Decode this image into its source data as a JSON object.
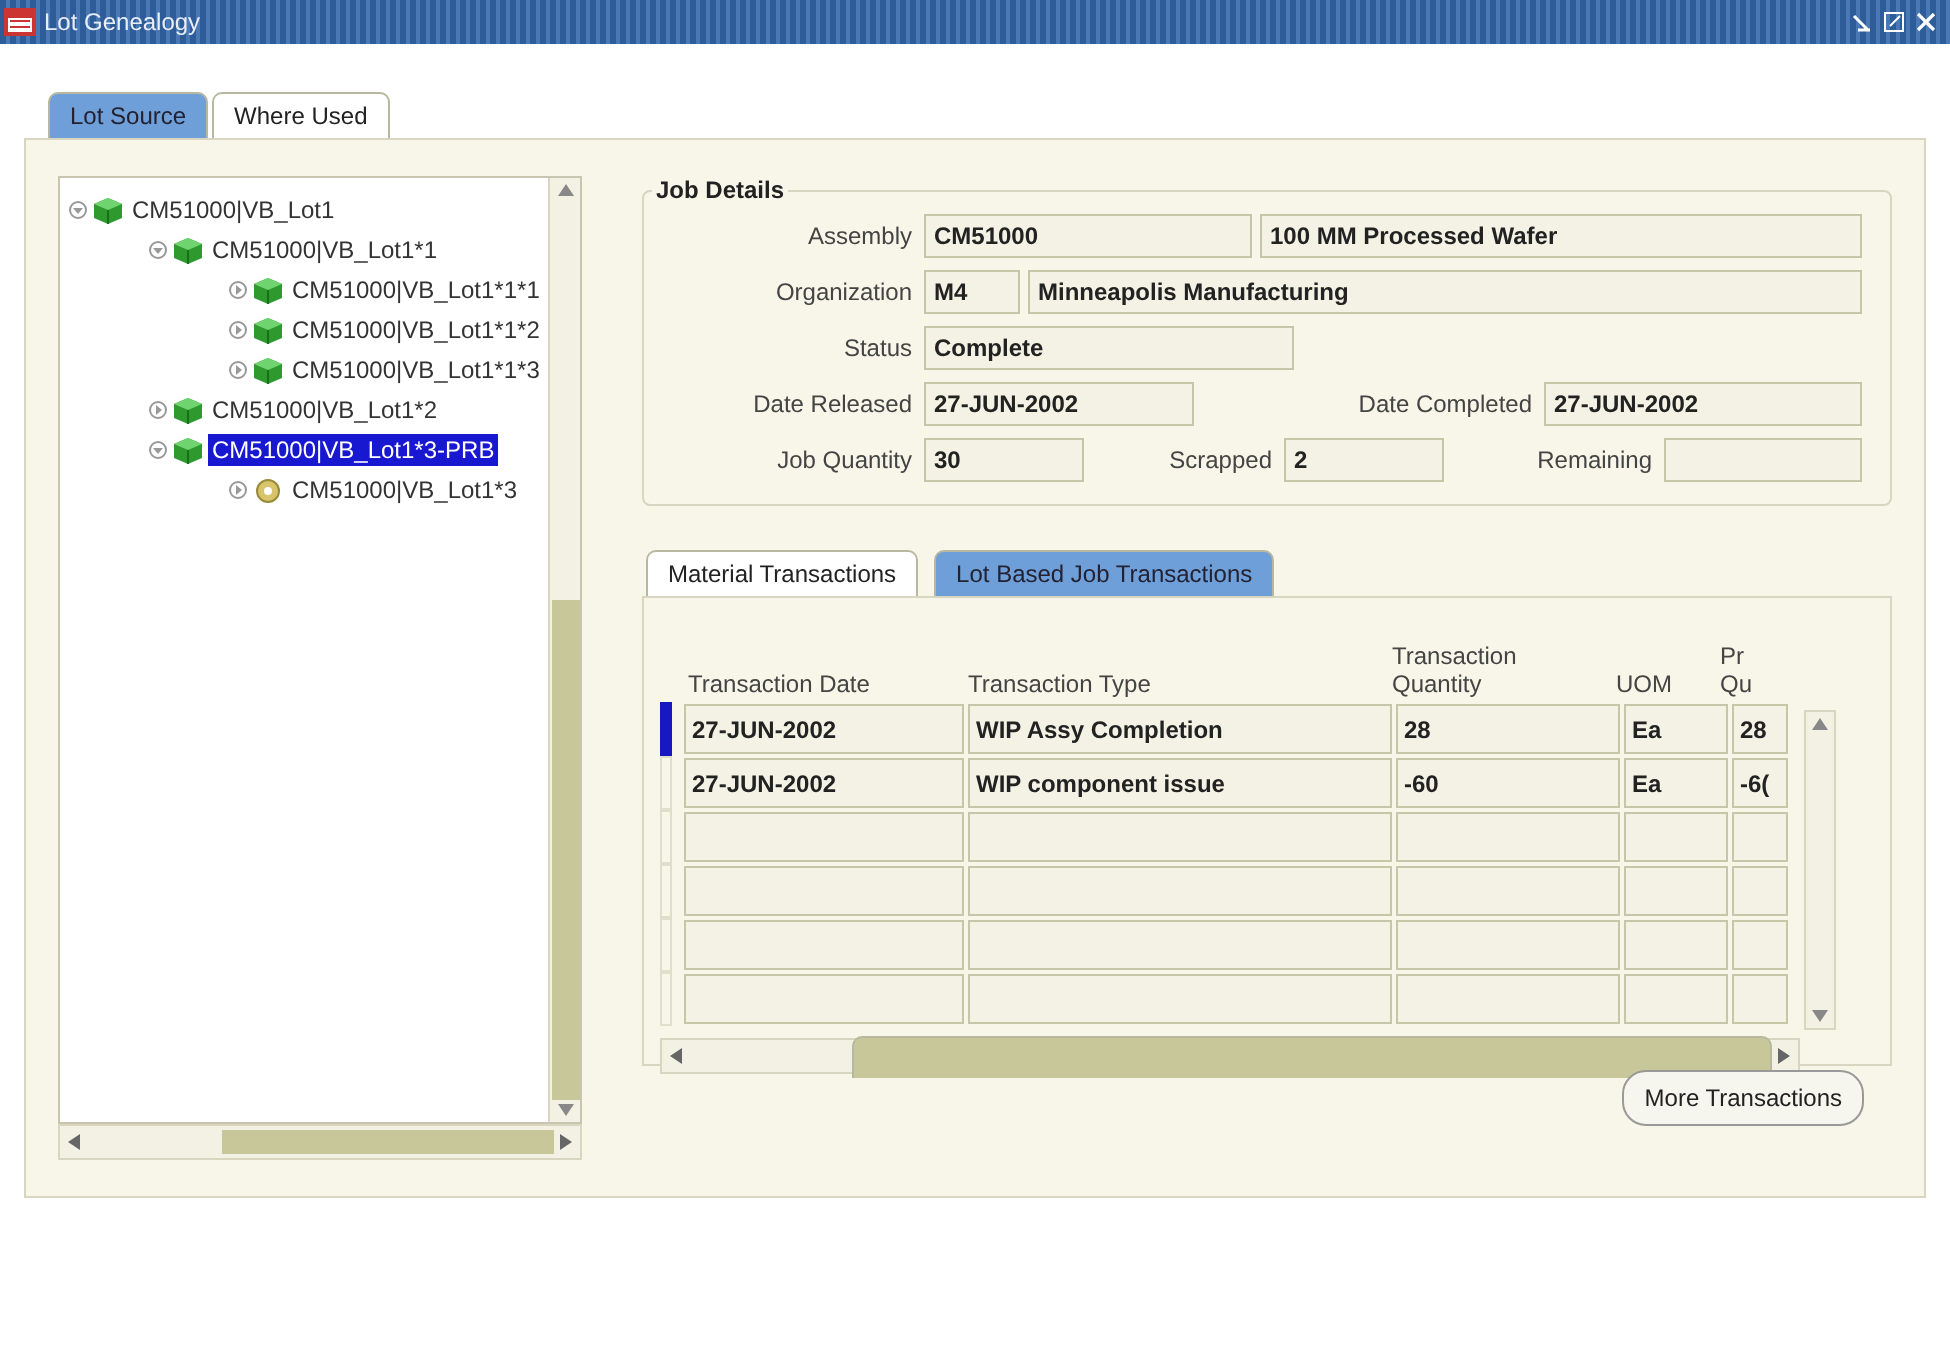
{
  "window": {
    "title": "Lot Genealogy"
  },
  "tabs": [
    {
      "label": "Lot Source",
      "selected": false
    },
    {
      "label": "Where Used",
      "selected": true
    }
  ],
  "tree": [
    {
      "label": "CM51000|VB_Lot1",
      "kind": "lot",
      "expanded": true,
      "selected": false,
      "children": [
        {
          "label": "CM51000|VB_Lot1*1",
          "kind": "lot",
          "expanded": true,
          "selected": false,
          "children": [
            {
              "label": "CM51000|VB_Lot1*1*1",
              "kind": "lot",
              "expanded": false,
              "selected": false
            },
            {
              "label": "CM51000|VB_Lot1*1*2",
              "kind": "lot",
              "expanded": false,
              "selected": false
            },
            {
              "label": "CM51000|VB_Lot1*1*3",
              "kind": "lot",
              "expanded": false,
              "selected": false
            }
          ]
        },
        {
          "label": "CM51000|VB_Lot1*2",
          "kind": "lot",
          "expanded": false,
          "selected": false
        },
        {
          "label": "CM51000|VB_Lot1*3-PRB",
          "kind": "lot",
          "expanded": true,
          "selected": true,
          "children": [
            {
              "label": "CM51000|VB_Lot1*3",
              "kind": "job",
              "expanded": false,
              "selected": false
            }
          ]
        }
      ]
    }
  ],
  "job_details": {
    "title": "Job Details",
    "assembly": {
      "label": "Assembly",
      "code": "CM51000",
      "description": "100 MM Processed Wafer"
    },
    "organization": {
      "label": "Organization",
      "code": "M4",
      "name": "Minneapolis Manufacturing"
    },
    "status": {
      "label": "Status",
      "value": "Complete"
    },
    "date_released": {
      "label": "Date Released",
      "value": "27-JUN-2002"
    },
    "date_completed": {
      "label": "Date Completed",
      "value": "27-JUN-2002"
    },
    "job_quantity": {
      "label": "Job Quantity",
      "value": "30"
    },
    "scrapped": {
      "label": "Scrapped",
      "value": "2"
    },
    "remaining": {
      "label": "Remaining"
    }
  },
  "transaction_tabs": [
    {
      "label": "Material Transactions",
      "selected": true
    },
    {
      "label": "Lot Based Job Transactions",
      "selected": false
    }
  ],
  "table": {
    "columns": [
      "Transaction Date",
      "Transaction Type",
      "Transaction Quantity",
      "UOM",
      "Pr Qu"
    ],
    "rows": [
      {
        "selected": true,
        "cells": [
          "27-JUN-2002",
          "WIP Assy Completion",
          "28",
          "Ea",
          "28"
        ]
      },
      {
        "selected": false,
        "cells": [
          "27-JUN-2002",
          "WIP component issue",
          "-60",
          "Ea",
          "-6("
        ]
      }
    ]
  },
  "buttons": [
    {
      "label": "More Transactions"
    }
  ]
}
